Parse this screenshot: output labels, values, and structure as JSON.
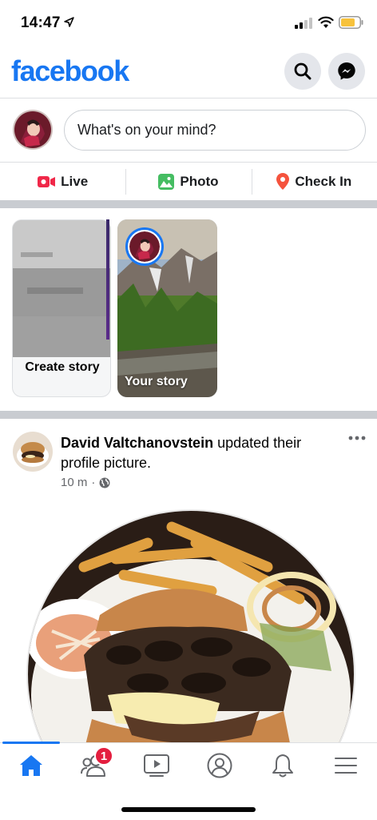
{
  "status_bar": {
    "time": "14:47",
    "icons": [
      "location-arrow-icon",
      "signal-icon",
      "wifi-icon",
      "battery-icon"
    ],
    "battery_color": "#f7c23c"
  },
  "header": {
    "logo": "facebook",
    "brand_color": "#1877f2",
    "buttons": [
      "search-icon",
      "messenger-icon"
    ]
  },
  "composer": {
    "placeholder": "What's on your mind?"
  },
  "actions": [
    {
      "label": "Live",
      "icon": "live-video-icon",
      "color": "#f02849"
    },
    {
      "label": "Photo",
      "icon": "photo-icon",
      "color": "#45bd62"
    },
    {
      "label": "Check In",
      "icon": "location-pin-icon",
      "color": "#f5533d"
    }
  ],
  "stories": {
    "create_label": "Create story",
    "own_label": "Your story"
  },
  "post": {
    "author": "David Valtchanovstein",
    "action_text": " updated their profile picture.",
    "time": "10 m",
    "separator": "·",
    "privacy_icon": "globe-icon"
  },
  "tabbar": {
    "tabs": [
      "home-icon",
      "friends-icon",
      "watch-icon",
      "profile-icon",
      "notifications-icon",
      "menu-icon"
    ],
    "active": "home-icon",
    "friends_badge": "1"
  }
}
